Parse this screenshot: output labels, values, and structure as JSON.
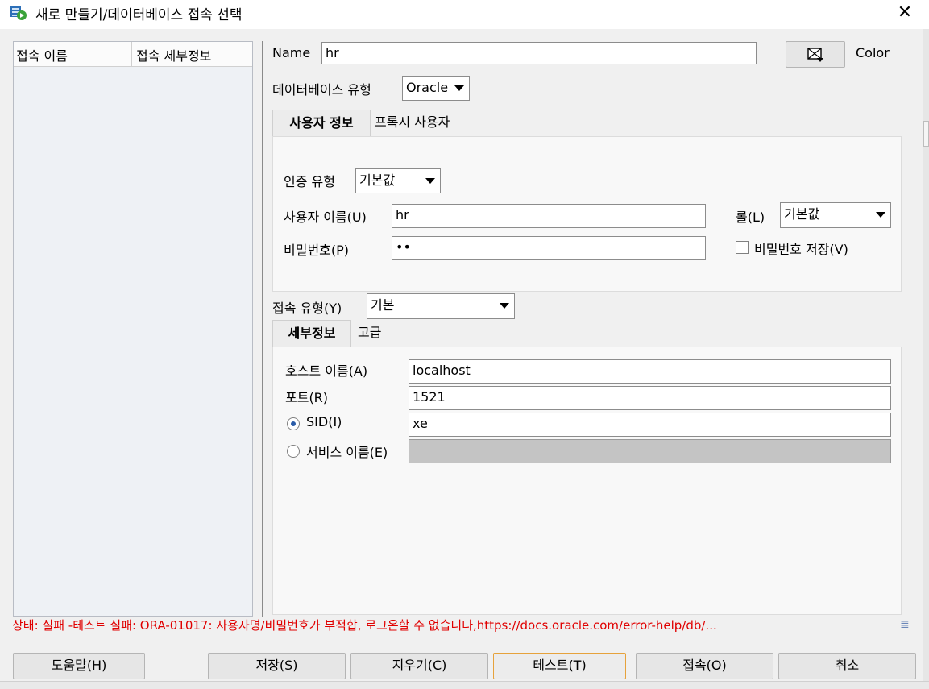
{
  "window": {
    "title": "새로 만들기/데이터베이스 접속 선택",
    "close_label": "✕"
  },
  "connection_list": {
    "columns": [
      "접속 이름",
      "접속 세부정보"
    ]
  },
  "form": {
    "name_label": "Name",
    "name_value": "hr",
    "color_label": "Color",
    "db_type_label": "데이터베이스 유형",
    "db_type_value": "Oracle",
    "tabs": [
      "사용자 정보",
      "프록시 사용자"
    ],
    "user_info": {
      "auth_type_label": "인증 유형",
      "auth_type_value": "기본값",
      "username_label": "사용자 이름(U)",
      "username_value": "hr",
      "role_label": "롤(L)",
      "role_value": "기본값",
      "password_label": "비밀번호(P)",
      "password_value": "••",
      "save_password_label": "비밀번호 저장(V)"
    },
    "conn_type_label": "접속 유형(Y)",
    "conn_type_value": "기본",
    "detail_tabs": [
      "세부정보",
      "고급"
    ],
    "details": {
      "host_label": "호스트 이름(A)",
      "host_value": "localhost",
      "port_label": "포트(R)",
      "port_value": "1521",
      "sid_label": "SID(I)",
      "sid_value": "xe",
      "service_label": "서비스 이름(E)"
    }
  },
  "status": "상태: 실패 -테스트 실패: ORA-01017: 사용자명/비밀번호가 부적합, 로그온할 수 없습니다,https://docs.oracle.com/error-help/db/...",
  "buttons": {
    "help": "도움말(H)",
    "save": "저장(S)",
    "clear": "지우기(C)",
    "test": "테스트(T)",
    "connect": "접속(O)",
    "cancel": "취소"
  }
}
